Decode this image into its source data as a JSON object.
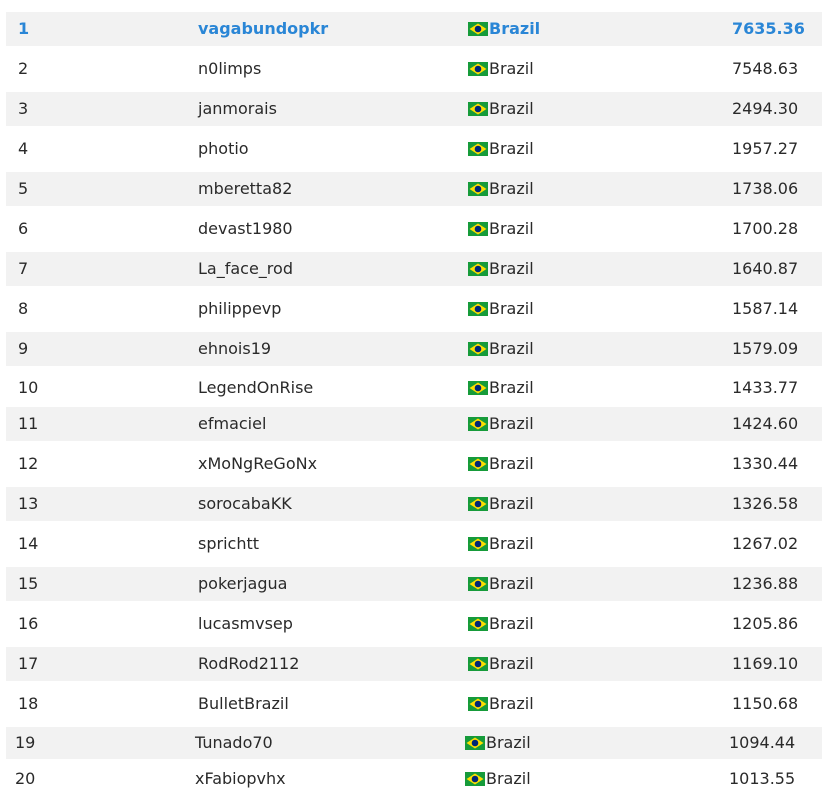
{
  "leaderboard": {
    "rows": [
      {
        "rank": "1",
        "name": "vagabundopkr",
        "country": "Brazil",
        "score": "7635.36"
      },
      {
        "rank": "2",
        "name": "n0limps",
        "country": "Brazil",
        "score": "7548.63"
      },
      {
        "rank": "3",
        "name": "janmorais",
        "country": "Brazil",
        "score": "2494.30"
      },
      {
        "rank": "4",
        "name": "photio",
        "country": "Brazil",
        "score": "1957.27"
      },
      {
        "rank": "5",
        "name": "mberetta82",
        "country": "Brazil",
        "score": "1738.06"
      },
      {
        "rank": "6",
        "name": "devast1980",
        "country": "Brazil",
        "score": "1700.28"
      },
      {
        "rank": "7",
        "name": "La_face_rod",
        "country": "Brazil",
        "score": "1640.87"
      },
      {
        "rank": "8",
        "name": "philippevp",
        "country": "Brazil",
        "score": "1587.14"
      },
      {
        "rank": "9",
        "name": "ehnois19",
        "country": "Brazil",
        "score": "1579.09"
      },
      {
        "rank": "10",
        "name": "LegendOnRise",
        "country": "Brazil",
        "score": "1433.77"
      },
      {
        "rank": "11",
        "name": "efmaciel",
        "country": "Brazil",
        "score": "1424.60"
      },
      {
        "rank": "12",
        "name": "xMoNgReGoNx",
        "country": "Brazil",
        "score": "1330.44"
      },
      {
        "rank": "13",
        "name": "sorocabaKK",
        "country": "Brazil",
        "score": "1326.58"
      },
      {
        "rank": "14",
        "name": "sprichtt",
        "country": "Brazil",
        "score": "1267.02"
      },
      {
        "rank": "15",
        "name": "pokerjagua",
        "country": "Brazil",
        "score": "1236.88"
      },
      {
        "rank": "16",
        "name": "lucasmvsep",
        "country": "Brazil",
        "score": "1205.86"
      },
      {
        "rank": "17",
        "name": "RodRod2112",
        "country": "Brazil",
        "score": "1169.10"
      },
      {
        "rank": "18",
        "name": "BulletBrazil",
        "country": "Brazil",
        "score": "1150.68"
      },
      {
        "rank": "19",
        "name": "Tunado70",
        "country": "Brazil",
        "score": "1094.44"
      },
      {
        "rank": "20",
        "name": "xFabiopvhx",
        "country": "Brazil",
        "score": "1013.55"
      }
    ]
  },
  "colors": {
    "highlight": "#2a86d6",
    "row_alt_bg": "#f2f2f2",
    "text": "#2a2a2a",
    "flag_green": "#169b3a",
    "flag_yellow": "#fedf00",
    "flag_blue": "#002776"
  },
  "icons": {
    "country_flag": "brazil-flag-icon"
  }
}
